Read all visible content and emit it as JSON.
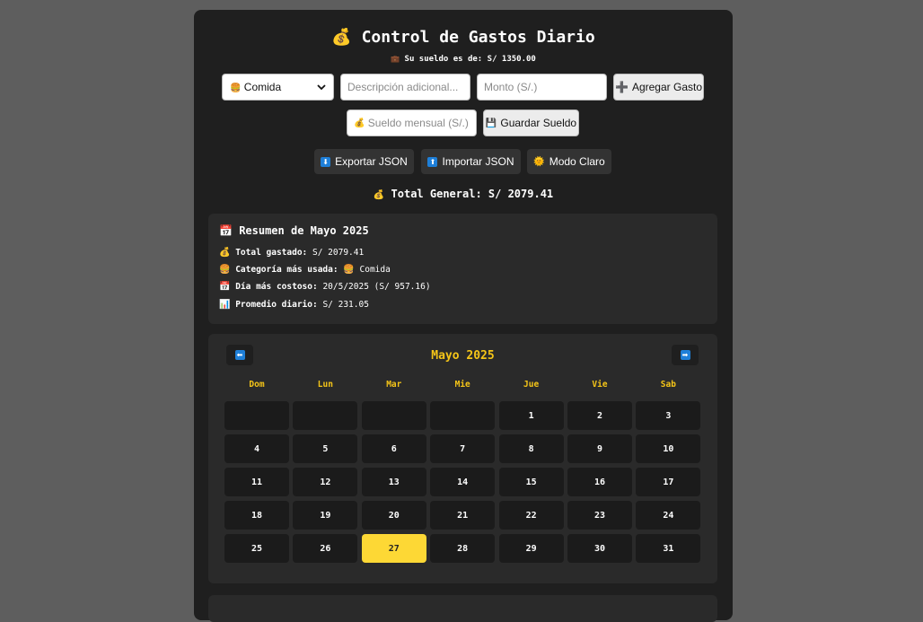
{
  "app": {
    "title_icon": "💰",
    "title": "Control de Gastos Diario",
    "salary_icon": "💼",
    "salary_text": "Su sueldo es de: S/ 1350.00"
  },
  "form": {
    "category_icon": "🍔",
    "category_value": "Comida",
    "description_placeholder": "Descripción adicional...",
    "amount_placeholder": "Monto (S/.)",
    "add_icon": "➕",
    "add_label": "Agregar Gasto",
    "salary_icon": "💰",
    "salary_placeholder": "Sueldo mensual (S/.)",
    "save_icon": "💾",
    "save_label": "Guardar Sueldo"
  },
  "toolbar": {
    "export_icon": "⬇",
    "export_label": "Exportar JSON",
    "import_icon": "⬆",
    "import_label": "Importar JSON",
    "theme_icon": "🌞",
    "theme_label": "Modo Claro"
  },
  "total": {
    "icon": "💰",
    "text": "Total General: S/ 2079.41"
  },
  "summary": {
    "icon": "📅",
    "title": "Resumen de Mayo 2025",
    "rows": [
      {
        "icon": "💰",
        "label": "Total gastado:",
        "value": "S/ 2079.41"
      },
      {
        "icon": "🍔",
        "label": "Categoría más usada:",
        "value_icon": "🍔",
        "value": "Comida"
      },
      {
        "icon": "📅",
        "label": "Día más costoso:",
        "value": "20/5/2025 (S/ 957.16)"
      },
      {
        "icon": "📊",
        "label": "Promedio diario:",
        "value": "S/ 231.05"
      }
    ]
  },
  "calendar": {
    "month_label": "Mayo 2025",
    "prev_icon": "⬅",
    "next_icon": "➡",
    "weekdays": [
      "Dom",
      "Lun",
      "Mar",
      "Mie",
      "Jue",
      "Vie",
      "Sab"
    ],
    "days": [
      "1",
      "2",
      "3",
      "4",
      "5",
      "6",
      "7",
      "8",
      "9",
      "10",
      "11",
      "12",
      "13",
      "14",
      "15",
      "16",
      "17",
      "18",
      "19",
      "20",
      "21",
      "22",
      "23",
      "24",
      "25",
      "26",
      "27",
      "28",
      "29",
      "30",
      "31"
    ],
    "today": "27",
    "accent_color": "#f5c518",
    "today_color": "#fdd835"
  }
}
